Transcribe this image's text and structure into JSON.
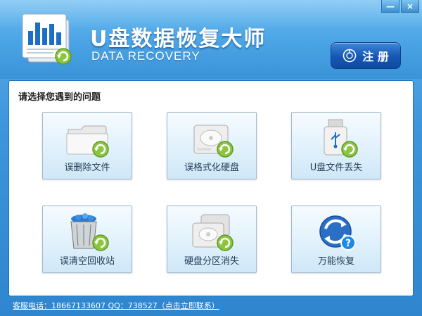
{
  "window": {
    "minimize_glyph": "—",
    "close_glyph": "×"
  },
  "header": {
    "title_cn": "U盘数据恢复大师",
    "title_en": "DATA RECOVERY",
    "register_label": "注 册"
  },
  "panel": {
    "prompt": "请选择您遇到的问题"
  },
  "options": [
    {
      "label": "误删除文件",
      "icon": "folder-recover-icon"
    },
    {
      "label": "误格式化硬盘",
      "icon": "harddisk-recover-icon"
    },
    {
      "label": "U盘文件丢失",
      "icon": "usb-drive-recover-icon"
    },
    {
      "label": "误清空回收站",
      "icon": "recycle-bin-recover-icon"
    },
    {
      "label": "硬盘分区消失",
      "icon": "partition-recover-icon"
    },
    {
      "label": "万能恢复",
      "icon": "universal-recover-icon"
    }
  ],
  "footer": {
    "contact": "客服电话：18667133607 QQ：738527（点击立即联系）"
  },
  "colors": {
    "accent_blue": "#3a93d8",
    "recover_green": "#8cc63f",
    "register_blue": "#1657b4"
  }
}
